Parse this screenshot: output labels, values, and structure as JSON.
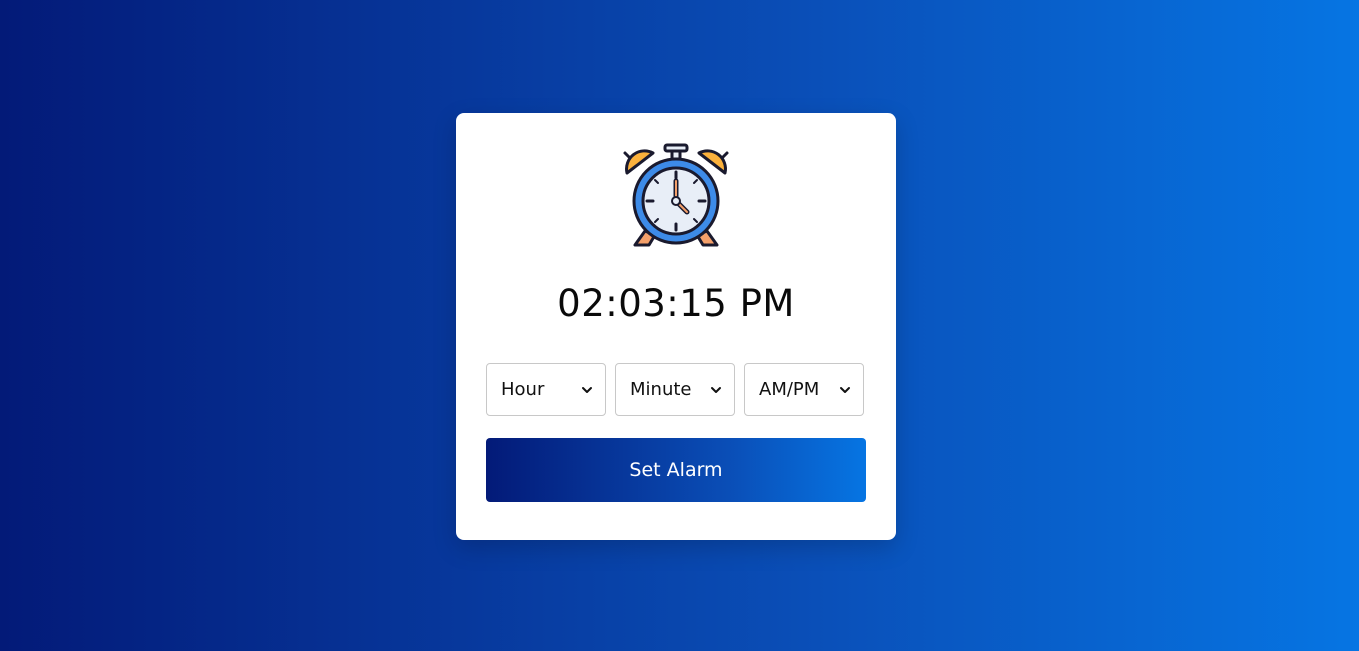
{
  "clock": {
    "icon": "alarm-clock-icon",
    "current_time": "02:03:15 PM"
  },
  "selects": {
    "hour": {
      "selected": "Hour",
      "icon": "chevron-down-icon"
    },
    "minute": {
      "selected": "Minute",
      "icon": "chevron-down-icon"
    },
    "ampm": {
      "selected": "AM/PM",
      "icon": "chevron-down-icon"
    }
  },
  "actions": {
    "set_alarm_label": "Set Alarm"
  },
  "colors": {
    "gradient_start": "#031a78",
    "gradient_end": "#0675e3",
    "clock_blue": "#3d8be8",
    "bell_orange": "#fbb13c",
    "hand_orange": "#f4a06a"
  }
}
